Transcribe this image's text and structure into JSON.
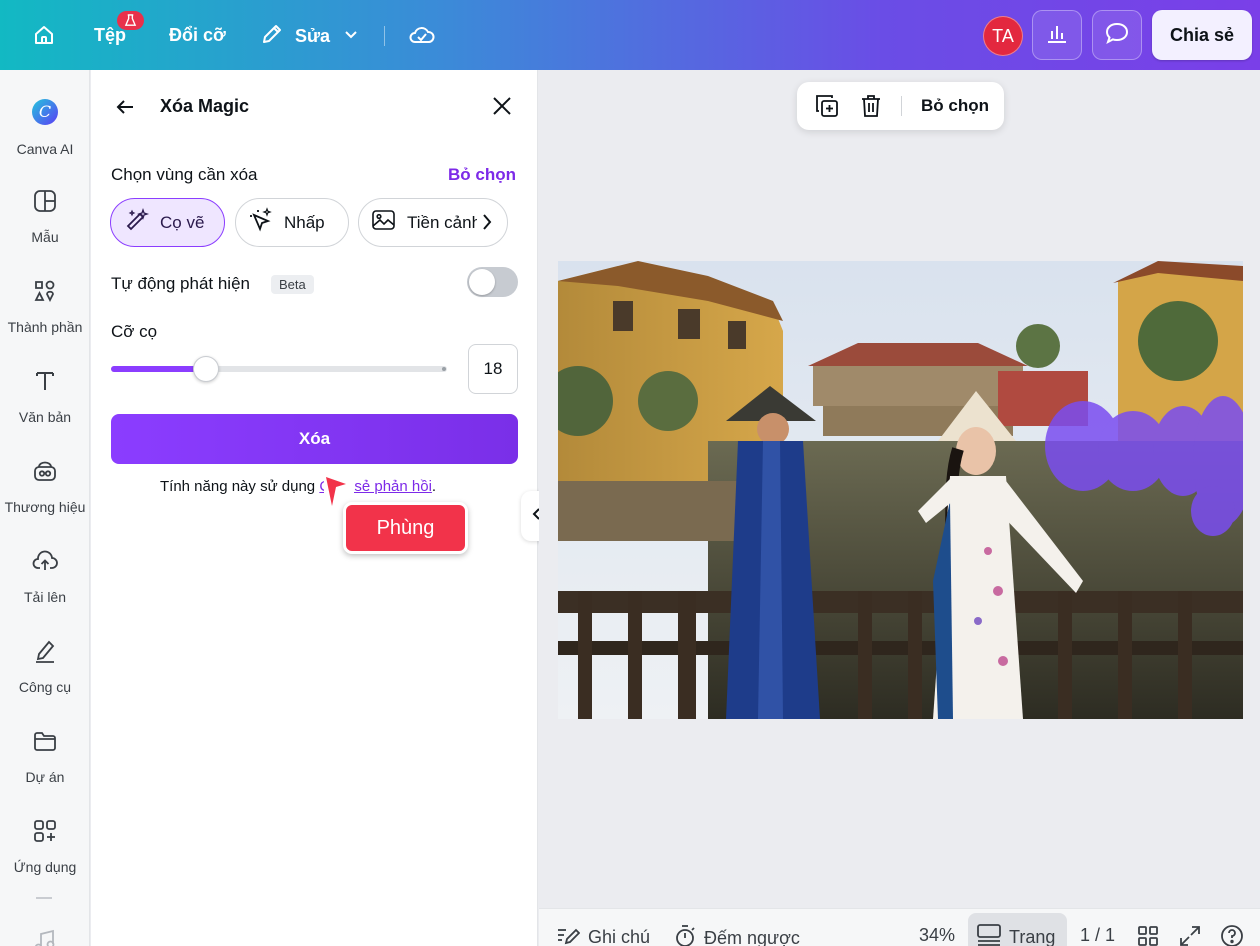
{
  "topbar": {
    "file_label": "Tệp",
    "resize_label": "Đổi cỡ",
    "edit_label": "Sửa",
    "avatar_initials": "TA",
    "share_label": "Chia sẻ"
  },
  "sidebar": {
    "items": [
      {
        "label": "Canva AI",
        "icon": "canva-ai-icon"
      },
      {
        "label": "Mẫu",
        "icon": "templates-icon"
      },
      {
        "label": "Thành phần",
        "icon": "elements-icon"
      },
      {
        "label": "Văn bản",
        "icon": "text-icon"
      },
      {
        "label": "Thương hiệu",
        "icon": "brand-icon"
      },
      {
        "label": "Tải lên",
        "icon": "upload-icon"
      },
      {
        "label": "Công cụ",
        "icon": "tools-icon"
      },
      {
        "label": "Dự án",
        "icon": "folder-icon"
      },
      {
        "label": "Ứng dụng",
        "icon": "apps-icon"
      }
    ]
  },
  "panel": {
    "title": "Xóa Magic",
    "select_area_label": "Chọn vùng cần xóa",
    "deselect_label": "Bỏ chọn",
    "modes": [
      {
        "label": "Cọ vẽ",
        "active": true
      },
      {
        "label": "Nhấp",
        "active": false
      },
      {
        "label": "Tiền cảnh",
        "active": false
      }
    ],
    "auto_detect_label": "Tự động phát hiện",
    "beta_label": "Beta",
    "auto_detect_on": false,
    "brush_size_label": "Cỡ cọ",
    "brush_size_value": "18",
    "brush_size_fraction": 0.18,
    "erase_button": "Xóa",
    "footnote_prefix": "Tính năng này sử dụng ",
    "footnote_link": "Chia sẻ phản hồi",
    "footnote_suffix": "."
  },
  "collaborator": {
    "name": "Phùng",
    "color": "#f2334a"
  },
  "canvas_toolbar": {
    "deselect_label": "Bỏ chọn"
  },
  "bottombar": {
    "notes_label": "Ghi chú",
    "timer_label": "Đếm ngược",
    "zoom": "34%",
    "page_label": "Trang",
    "page_count": "1 / 1"
  },
  "colors": {
    "accent": "#8b3dff",
    "link": "#7d2ae8",
    "avatar": "#e3283f"
  }
}
